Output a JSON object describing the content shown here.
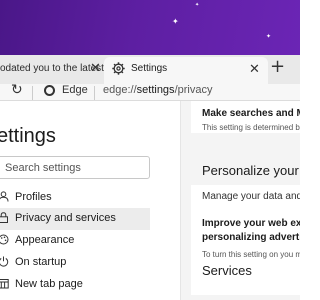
{
  "tabs": [
    {
      "title": "odated you to the latest",
      "active": false
    },
    {
      "title": "Settings",
      "active": true
    }
  ],
  "toolbar": {
    "site_label": "Edge",
    "url_scheme": "edge://",
    "url_path": "settings",
    "url_rest": "/privacy"
  },
  "sidebar": {
    "title": "ettings",
    "search_placeholder": "Search settings",
    "items": [
      {
        "label": "Profiles",
        "icon": "person-icon"
      },
      {
        "label": "Privacy and services",
        "icon": "lock-icon",
        "selected": true
      },
      {
        "label": "Appearance",
        "icon": "appearance-icon"
      },
      {
        "label": "On startup",
        "icon": "power-icon"
      },
      {
        "label": "New tab page",
        "icon": "new-tab-page-icon"
      }
    ]
  },
  "main": {
    "make_searches": "Make searches and Mic",
    "determined": "This setting is determined b",
    "personalize_heading": "Personalize your",
    "manage": "Manage your data and a",
    "improve_line1": "Improve your web expe",
    "improve_line2": "personalizing advertisi",
    "turn_on": "To turn this setting on you m",
    "services_heading": "Services"
  },
  "colors": {
    "wallpaper": "#5d1fa2",
    "tabbar": "#e9e9e9",
    "selected": "#ececec",
    "main_bg": "#f4f4f4"
  }
}
